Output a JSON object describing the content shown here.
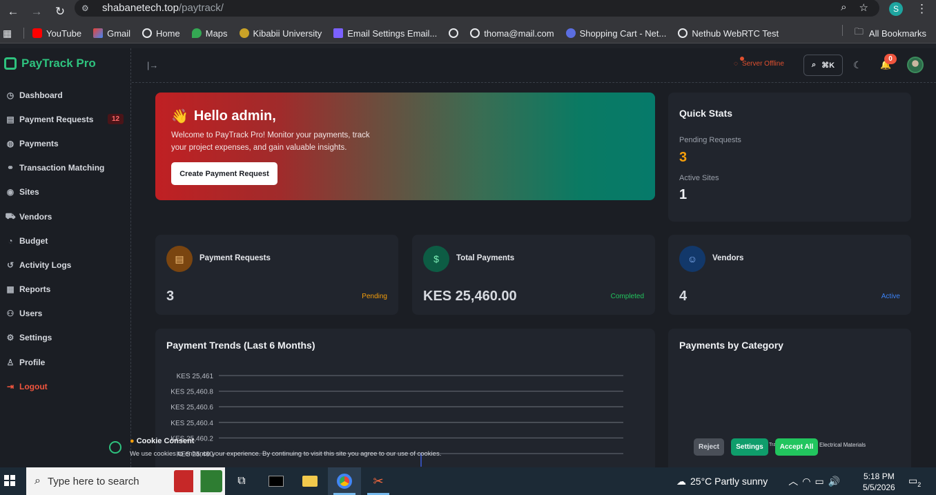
{
  "browser": {
    "url_host": "shabanetech.top",
    "url_path": "/paytrack/",
    "profile_initial": "S",
    "bookmarks": [
      "YouTube",
      "Gmail",
      "Home",
      "Maps",
      "Kibabii University",
      "Email Settings Email...",
      "thoma@mail.com",
      "Shopping Cart - Net...",
      "Nethub WebRTC Test"
    ],
    "all_bookmarks": "All Bookmarks"
  },
  "app": {
    "brand": "PayTrack Pro",
    "nav": [
      {
        "label": "Dashboard",
        "icon": "dashboard-icon"
      },
      {
        "label": "Payment Requests",
        "icon": "file-icon",
        "badge": "12"
      },
      {
        "label": "Payments",
        "icon": "wallet-icon"
      },
      {
        "label": "Transaction Matching",
        "icon": "link-icon"
      },
      {
        "label": "Sites",
        "icon": "location-icon"
      },
      {
        "label": "Vendors",
        "icon": "truck-icon"
      },
      {
        "label": "Budget",
        "icon": "pie-icon"
      },
      {
        "label": "Activity Logs",
        "icon": "history-icon"
      },
      {
        "label": "Reports",
        "icon": "report-icon"
      },
      {
        "label": "Users",
        "icon": "users-icon"
      },
      {
        "label": "Settings",
        "icon": "gear-icon"
      },
      {
        "label": "Profile",
        "icon": "user-icon"
      },
      {
        "label": "Logout",
        "icon": "logout-icon"
      }
    ],
    "topbar": {
      "server_status": "Server Offline",
      "search_shortcut": "⌘K",
      "notif_count": "0"
    },
    "hero": {
      "emoji": "👋",
      "title": "Hello admin,",
      "subtitle": "Welcome to PayTrack Pro! Monitor your payments, track your project expenses, and gain valuable insights.",
      "button": "Create Payment Request"
    },
    "quick_stats": {
      "title": "Quick Stats",
      "pending_label": "Pending Requests",
      "pending_value": "3",
      "sites_label": "Active Sites",
      "sites_value": "1"
    },
    "stats": [
      {
        "label": "Payment Requests",
        "value": "3",
        "tag": "Pending",
        "color": "#f59e0b"
      },
      {
        "label": "Total Payments",
        "value": "KES 25,460.00",
        "tag": "Completed",
        "color": "#22c55e"
      },
      {
        "label": "Vendors",
        "value": "4",
        "tag": "Active",
        "color": "#3b82f6"
      }
    ],
    "trend": {
      "title": "Payment Trends (Last 6 Months)"
    },
    "category": {
      "title": "Payments by Category",
      "legend_partial": "Tra",
      "legend_item": "Electrical Materials"
    },
    "cookie": {
      "title": "Cookie Consent",
      "text": "We use cookies to enhance your experience. By continuing to visit this site you agree to our use of cookies.",
      "reject": "Reject",
      "settings": "Settings",
      "accept": "Accept All"
    }
  },
  "chart_data": {
    "type": "line",
    "title": "Payment Trends (Last 6 Months)",
    "yticks": [
      "KES 25,461",
      "KES 25,460.8",
      "KES 25,460.6",
      "KES 25,460.4",
      "KES 25,460.2",
      "KES 25,460"
    ],
    "ylim": [
      25460,
      25461
    ],
    "grid": true
  },
  "taskbar": {
    "search_placeholder": "Type here to search",
    "weather": "25°C  Partly sunny",
    "time": "5:18 PM",
    "date": "5/5/2026",
    "notif_count": "2"
  }
}
